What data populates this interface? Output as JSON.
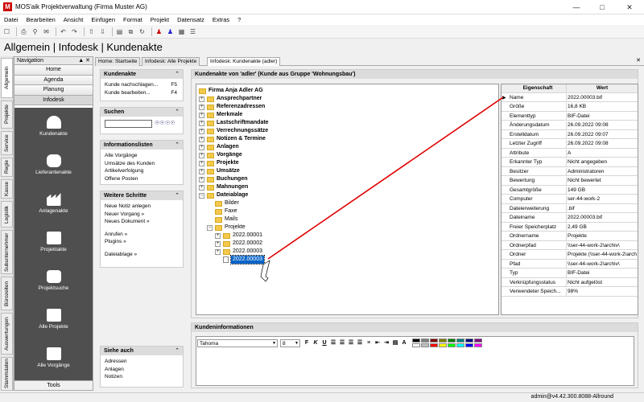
{
  "window": {
    "title": "MOS'aik Projektverwaltung (Firma Muster AG)"
  },
  "menu": [
    "Datei",
    "Bearbeiten",
    "Ansicht",
    "Einfügen",
    "Format",
    "Projekt",
    "Datensatz",
    "Extras",
    "?"
  ],
  "page_title": "Allgemein | Infodesk | Kundenakte",
  "vertical_tabs": [
    "Allgemein",
    "Projekte",
    "Service",
    "Regie",
    "Kasse",
    "Logistik",
    "Subunternehmer",
    "Bürozeiten",
    "Auswertungen",
    "Stammdaten"
  ],
  "navigation": {
    "title": "Navigation",
    "top_buttons": [
      "Home",
      "Agenda",
      "Planung",
      "Infodesk"
    ],
    "items": [
      {
        "label": "Kundenakte",
        "icon": "person-icon"
      },
      {
        "label": "Lieferantenakte",
        "icon": "delivery-person-icon"
      },
      {
        "label": "Anlagenakte",
        "icon": "factory-icon"
      },
      {
        "label": "Projektakte",
        "icon": "folder-check-icon"
      },
      {
        "label": "Projektsuche",
        "icon": "magnifier-icon"
      },
      {
        "label": "Alle Projekte",
        "icon": "folders-icon"
      },
      {
        "label": "Alle Vorgänge",
        "icon": "documents-icon"
      }
    ],
    "tools": "Tools"
  },
  "doc_tabs": [
    "Home: Startseite",
    "Infodesk: Alle Projekte",
    "Infodesk: Kundenakte (adler)"
  ],
  "sidebar": {
    "kundenakte": {
      "title": "Kundenakte",
      "items": [
        {
          "label": "Kunde nachschlagen...",
          "key": "F5"
        },
        {
          "label": "Kunde bearbeiten...",
          "key": "F4"
        }
      ]
    },
    "suchen": {
      "title": "Suchen",
      "value": ""
    },
    "infolisten": {
      "title": "Informationslisten",
      "items": [
        "Alle Vorgänge",
        "Umsätze des Kunden",
        "Artikelverfolgung",
        "Offene Posten"
      ]
    },
    "schritte": {
      "title": "Weitere Schritte",
      "items": [
        "Neue Notiz anlegen",
        "Neuer Vorgang »",
        "Neues Dokument »",
        "Anrufen »",
        "Plugins »",
        "Dateiablage »"
      ]
    },
    "siehe": {
      "title": "Siehe auch",
      "items": [
        "Adressen",
        "Anlagen",
        "Notizen"
      ]
    }
  },
  "kundenakte_panel": {
    "title": "Kundenakte von 'adler' (Kunde aus Gruppe 'Wohnungsbau')"
  },
  "tree": {
    "root": "Firma Anja Adler AG",
    "categories": [
      "Ansprechpartner",
      "Referenzadressen",
      "Merkmale",
      "Lastschriftmandate",
      "Verrechnungssätze",
      "Notizen & Termine",
      "Anlagen",
      "Vorgänge",
      "Projekte",
      "Umsätze",
      "Buchungen",
      "Mahnungen",
      "Dateiablage"
    ],
    "dateiablage": [
      "Bilder",
      "Faxe",
      "Mails",
      "Projekte"
    ],
    "projekte_children": [
      "2022.00001",
      "2022.00002",
      "2022.00003"
    ],
    "selected_file": "2022.00003"
  },
  "properties": {
    "headers": [
      "Eigenschaft",
      "Wert"
    ],
    "rows": [
      [
        "Name",
        "2022.00003.bif"
      ],
      [
        "Größe",
        "16,8 KB"
      ],
      [
        "Elementtyp",
        "BIF-Datei"
      ],
      [
        "Änderungsdatum",
        "26.09.2022 09:08"
      ],
      [
        "Erstelldatum",
        "26.09.2022 09:07"
      ],
      [
        "Letzter Zugriff",
        "26.09.2022 09:08"
      ],
      [
        "Attribute",
        "A"
      ],
      [
        "Erkannter Typ",
        "Nicht angegeben"
      ],
      [
        "Besitzer",
        "Administratoren"
      ],
      [
        "Bewertung",
        "Nicht bewertet"
      ],
      [
        "Gesamtgröße",
        "149 GB"
      ],
      [
        "Computer",
        "ser-44-work-2"
      ],
      [
        "Dateierweiterung",
        ".bif"
      ],
      [
        "Dateiname",
        "2022.00003.bif"
      ],
      [
        "Freier Speicherplatz",
        "2,49 GB"
      ],
      [
        "Ordnername",
        "Projekte"
      ],
      [
        "Ordnerpfad",
        "\\\\ser-44-work-2\\archiv\\"
      ],
      [
        "Ordner",
        "Projekte (\\\\ser-44-work-2\\archiv\\"
      ],
      [
        "Pfad",
        "\\\\ser-44-work-2\\archiv\\"
      ],
      [
        "Typ",
        "BIF-Datei"
      ],
      [
        "Verknüpfungsstatus",
        "Nicht aufgelöst"
      ],
      [
        "Verwendeter Speich...",
        "98%"
      ]
    ]
  },
  "kundeninfo": {
    "title": "Kundeninformationen",
    "font": "Tahoma",
    "size": "8"
  },
  "status": {
    "text": "admin@v4.42.300.8088-Allround"
  },
  "colors": {
    "accent": "#0a64c8",
    "nav_dark": "#4f4f4f",
    "annotation": "#e00000",
    "folder": "#f2c94c"
  }
}
